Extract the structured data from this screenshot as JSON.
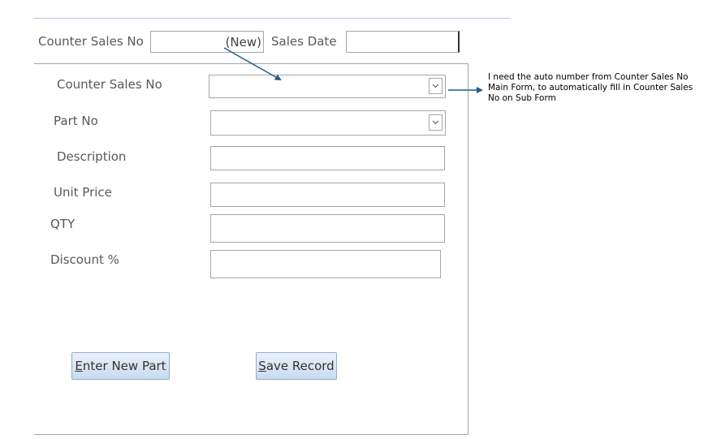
{
  "main_form": {
    "counter_sales_no_label": "Counter Sales No",
    "counter_sales_no_value": "(New)",
    "sales_date_label": "Sales Date",
    "sales_date_value": ""
  },
  "sub_form": {
    "fields": [
      {
        "label": "Counter Sales No",
        "type": "combo",
        "value": ""
      },
      {
        "label": "Part No",
        "type": "combo",
        "value": ""
      },
      {
        "label": "Description",
        "type": "text",
        "value": ""
      },
      {
        "label": "Unit Price",
        "type": "text",
        "value": ""
      },
      {
        "label": "QTY",
        "type": "text",
        "value": ""
      },
      {
        "label": "Discount %",
        "type": "text",
        "value": ""
      }
    ],
    "buttons": {
      "enter_new_part": {
        "hotkey": "E",
        "rest": "nter New Part"
      },
      "save_record": {
        "hotkey": "S",
        "rest": "ave Record"
      }
    }
  },
  "annotation": {
    "note_lines": [
      "I need the auto number from Counter Sales No",
      "Main Form, to automatically fill in Counter Sales",
      "No on Sub Form"
    ],
    "arrow_color": "#1f5c8a"
  },
  "icons": {
    "dropdown": "chevron-down-icon"
  }
}
